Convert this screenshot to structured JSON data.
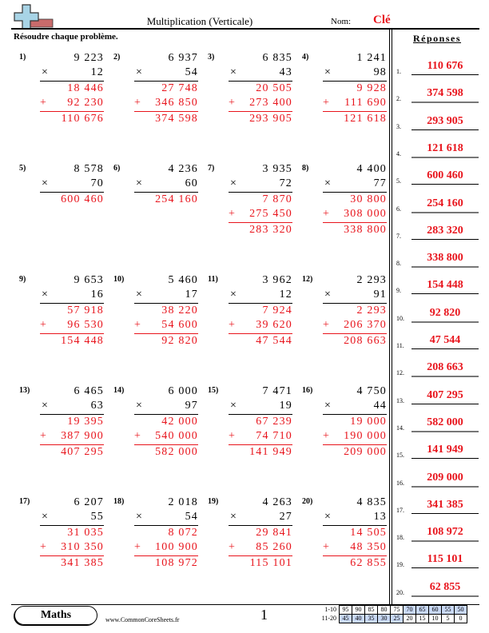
{
  "header": {
    "title": "Multiplication (Verticale)",
    "name_label": "Nom:",
    "name_value": "Clé",
    "instructions": "Résoudre chaque problème.",
    "answers_heading": "Réponses",
    "logo_icon": "plus-sign-logo-icon"
  },
  "colors": {
    "answer_red": "#e8141c",
    "score_highlight": "#c8d8f5"
  },
  "problems": [
    {
      "num": "1)",
      "top": "9 223",
      "mult": "12",
      "p1": "18 446",
      "p2": "92 230",
      "result": "110 676"
    },
    {
      "num": "2)",
      "top": "6 937",
      "mult": "54",
      "p1": "27 748",
      "p2": "346 850",
      "result": "374 598"
    },
    {
      "num": "3)",
      "top": "6 835",
      "mult": "43",
      "p1": "20 505",
      "p2": "273 400",
      "result": "293 905"
    },
    {
      "num": "4)",
      "top": "1 241",
      "mult": "98",
      "p1": "9 928",
      "p2": "111 690",
      "result": "121 618"
    },
    {
      "num": "5)",
      "top": "8 578",
      "mult": "70",
      "p1": null,
      "p2": null,
      "result": "600 460"
    },
    {
      "num": "6)",
      "top": "4 236",
      "mult": "60",
      "p1": null,
      "p2": null,
      "result": "254 160"
    },
    {
      "num": "7)",
      "top": "3 935",
      "mult": "72",
      "p1": "7 870",
      "p2": "275 450",
      "result": "283 320"
    },
    {
      "num": "8)",
      "top": "4 400",
      "mult": "77",
      "p1": "30 800",
      "p2": "308 000",
      "result": "338 800"
    },
    {
      "num": "9)",
      "top": "9 653",
      "mult": "16",
      "p1": "57 918",
      "p2": "96 530",
      "result": "154 448"
    },
    {
      "num": "10)",
      "top": "5 460",
      "mult": "17",
      "p1": "38 220",
      "p2": "54 600",
      "result": "92 820"
    },
    {
      "num": "11)",
      "top": "3 962",
      "mult": "12",
      "p1": "7 924",
      "p2": "39 620",
      "result": "47 544"
    },
    {
      "num": "12)",
      "top": "2 293",
      "mult": "91",
      "p1": "2 293",
      "p2": "206 370",
      "result": "208 663"
    },
    {
      "num": "13)",
      "top": "6 465",
      "mult": "63",
      "p1": "19 395",
      "p2": "387 900",
      "result": "407 295"
    },
    {
      "num": "14)",
      "top": "6 000",
      "mult": "97",
      "p1": "42 000",
      "p2": "540 000",
      "result": "582 000"
    },
    {
      "num": "15)",
      "top": "7 471",
      "mult": "19",
      "p1": "67 239",
      "p2": "74 710",
      "result": "141 949"
    },
    {
      "num": "16)",
      "top": "4 750",
      "mult": "44",
      "p1": "19 000",
      "p2": "190 000",
      "result": "209 000"
    },
    {
      "num": "17)",
      "top": "6 207",
      "mult": "55",
      "p1": "31 035",
      "p2": "310 350",
      "result": "341 385"
    },
    {
      "num": "18)",
      "top": "2 018",
      "mult": "54",
      "p1": "8 072",
      "p2": "100 900",
      "result": "108 972"
    },
    {
      "num": "19)",
      "top": "4 263",
      "mult": "27",
      "p1": "29 841",
      "p2": "85 260",
      "result": "115 101"
    },
    {
      "num": "20)",
      "top": "4 835",
      "mult": "13",
      "p1": "14 505",
      "p2": "48 350",
      "result": "62 855"
    }
  ],
  "symbols": {
    "times": "×",
    "plus": "+"
  },
  "answers": [
    {
      "num": "1.",
      "value": "110 676"
    },
    {
      "num": "2.",
      "value": "374 598"
    },
    {
      "num": "3.",
      "value": "293 905"
    },
    {
      "num": "4.",
      "value": "121 618"
    },
    {
      "num": "5.",
      "value": "600 460"
    },
    {
      "num": "6.",
      "value": "254 160"
    },
    {
      "num": "7.",
      "value": "283 320"
    },
    {
      "num": "8.",
      "value": "338 800"
    },
    {
      "num": "9.",
      "value": "154 448"
    },
    {
      "num": "10.",
      "value": "92 820"
    },
    {
      "num": "11.",
      "value": "47 544"
    },
    {
      "num": "12.",
      "value": "208 663"
    },
    {
      "num": "13.",
      "value": "407 295"
    },
    {
      "num": "14.",
      "value": "582 000"
    },
    {
      "num": "15.",
      "value": "141 949"
    },
    {
      "num": "16.",
      "value": "209 000"
    },
    {
      "num": "17.",
      "value": "341 385"
    },
    {
      "num": "18.",
      "value": "108 972"
    },
    {
      "num": "19.",
      "value": "115 101"
    },
    {
      "num": "20.",
      "value": "62 855"
    }
  ],
  "footer": {
    "subject": "Maths",
    "website": "www.CommonCoreSheets.fr",
    "page_number": "1",
    "score_rows": [
      {
        "label": "1-10",
        "values": [
          "95",
          "90",
          "85",
          "80",
          "75",
          "70",
          "65",
          "60",
          "55",
          "50"
        ],
        "highlighted_from": 5
      },
      {
        "label": "11-20",
        "values": [
          "45",
          "40",
          "35",
          "30",
          "25",
          "20",
          "15",
          "10",
          "5",
          "0"
        ],
        "highlighted_until": 4
      }
    ]
  }
}
